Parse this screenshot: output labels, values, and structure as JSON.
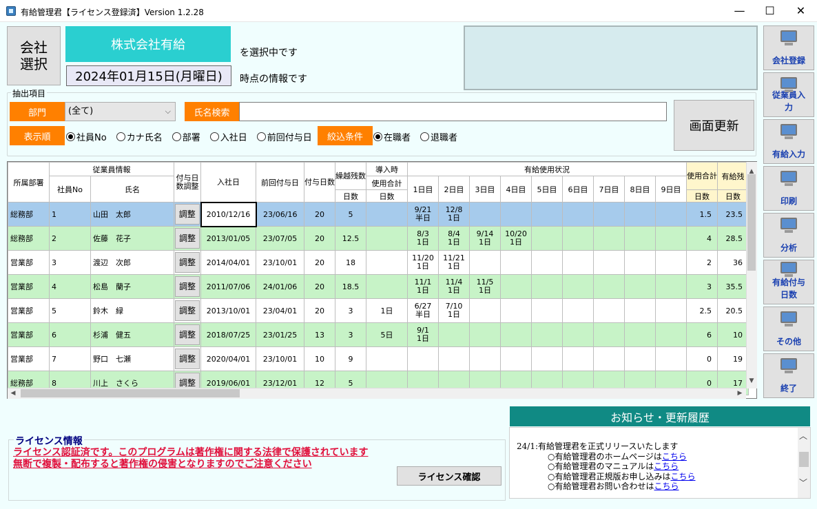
{
  "window": {
    "title": "有給管理君【ライセンス登録済】Version 1.2.28",
    "minimize": "—",
    "maximize": "☐",
    "close": "✕"
  },
  "top": {
    "company_select_label": "会社選択",
    "company_name": "株式会社有給",
    "selecting_text": "を選択中です",
    "date": "2024年01月15日(月曜日)",
    "asof_text": "時点の情報です"
  },
  "filter": {
    "legend": "抽出項目",
    "dept_label": "部門",
    "dept_value": "(全て)",
    "name_search_label": "氏名検索",
    "name_search_value": "",
    "sort_label": "表示順",
    "sort_options": [
      "社員No",
      "カナ氏名",
      "部署",
      "入社日",
      "前回付与日"
    ],
    "sort_selected": 0,
    "condition_label": "絞込条件",
    "condition_options": [
      "在職者",
      "退職者"
    ],
    "condition_selected": 0,
    "refresh_button": "画面更新"
  },
  "table": {
    "headers": {
      "dept": "所属部署",
      "employee_info": "従業員情報",
      "emp_no": "社員No",
      "name": "氏名",
      "adjust": "付与日数調整",
      "hire_date": "入社日",
      "last_grant": "前回付与日",
      "grant_days": "付与日数",
      "carryover": "繰越残数",
      "carryover_unit": "日数",
      "intro": "導入時",
      "intro_used": "使用合計",
      "intro_unit": "日数",
      "usage": "有給使用状況",
      "days": [
        "1日目",
        "2日目",
        "3日目",
        "4日目",
        "5日目",
        "6日目",
        "7日目",
        "8日目",
        "9日目"
      ],
      "used_total": "使用合計",
      "used_unit": "日数",
      "remaining": "有給残",
      "remaining_unit": "日数"
    },
    "adjust_button": "調整",
    "rows": [
      {
        "dept": "総務部",
        "no": "1",
        "name": "山田　太郎",
        "hire": "2010/12/16",
        "last": "23/06/16",
        "grant": "20",
        "carry": "5",
        "intro": "",
        "days": [
          [
            "9/21",
            "半日"
          ],
          [
            "12/8",
            "1日"
          ]
        ],
        "used": "1.5",
        "remain": "23.5",
        "style": "sel"
      },
      {
        "dept": "総務部",
        "no": "2",
        "name": "佐藤　花子",
        "hire": "2013/01/05",
        "last": "23/07/05",
        "grant": "20",
        "carry": "12.5",
        "intro": "",
        "days": [
          [
            "8/3",
            "1日"
          ],
          [
            "8/4",
            "1日"
          ],
          [
            "9/14",
            "1日"
          ],
          [
            "10/20",
            "1日"
          ]
        ],
        "used": "4",
        "remain": "28.5",
        "style": "green"
      },
      {
        "dept": "営業部",
        "no": "3",
        "name": "渡辺　次郎",
        "hire": "2014/04/01",
        "last": "23/10/01",
        "grant": "20",
        "carry": "18",
        "intro": "",
        "days": [
          [
            "11/20",
            "1日"
          ],
          [
            "11/21",
            "1日"
          ]
        ],
        "used": "2",
        "remain": "36",
        "style": "white"
      },
      {
        "dept": "営業部",
        "no": "4",
        "name": "松島　蘭子",
        "hire": "2011/07/06",
        "last": "24/01/06",
        "grant": "20",
        "carry": "18.5",
        "intro": "",
        "days": [
          [
            "11/1",
            "1日"
          ],
          [
            "11/4",
            "1日"
          ],
          [
            "11/5",
            "1日"
          ]
        ],
        "used": "3",
        "remain": "35.5",
        "style": "green"
      },
      {
        "dept": "営業部",
        "no": "5",
        "name": "鈴木　緑",
        "hire": "2013/10/01",
        "last": "23/04/01",
        "grant": "20",
        "carry": "3",
        "intro": "1日",
        "days": [
          [
            "6/27",
            "半日"
          ],
          [
            "7/10",
            "1日"
          ]
        ],
        "used": "2.5",
        "remain": "20.5",
        "style": "white"
      },
      {
        "dept": "営業部",
        "no": "6",
        "name": "杉浦　健五",
        "hire": "2018/07/25",
        "last": "23/01/25",
        "grant": "13",
        "carry": "3",
        "intro": "5日",
        "days": [
          [
            "9/1",
            "1日"
          ]
        ],
        "used": "6",
        "remain": "10",
        "style": "green"
      },
      {
        "dept": "営業部",
        "no": "7",
        "name": "野口　七瀬",
        "hire": "2020/04/01",
        "last": "23/10/01",
        "grant": "10",
        "carry": "9",
        "intro": "",
        "days": [],
        "used": "0",
        "remain": "19",
        "style": "white"
      },
      {
        "dept": "総務部",
        "no": "8",
        "name": "川上　さくら",
        "hire": "2019/06/01",
        "last": "23/12/01",
        "grant": "12",
        "carry": "5",
        "intro": "",
        "days": [],
        "used": "0",
        "remain": "17",
        "style": "green"
      }
    ]
  },
  "sidebar": {
    "items": [
      "会社登録",
      "従業員入力",
      "有給入力",
      "印刷",
      "分析",
      "有給付与日数",
      "その他",
      "終了"
    ]
  },
  "news": {
    "title": "お知らせ・更新履歴",
    "headline": "24/1:有給管理君を正式リリースいたします",
    "links": [
      {
        "text": "○有給管理君のホームページは",
        "link": "こちら"
      },
      {
        "text": "○有給管理君のマニュアルは",
        "link": "こちら"
      },
      {
        "text": "○有給管理君正規版お申し込みは",
        "link": "こちら"
      },
      {
        "text": "○有給管理君お問い合わせは",
        "link": "こちら"
      }
    ]
  },
  "license": {
    "title": "ライセンス情報",
    "line1": "ライセンス認証済です。このプログラムは著作権に関する法律で保護されています",
    "line2": "無断で複製・配布すると著作権の侵害となりますのでご注意ください",
    "button": "ライセンス確認"
  },
  "colors": {
    "accent_orange": "#ff8000",
    "company_teal": "#2acfd0",
    "news_teal": "#108a84",
    "row_green": "#c7f3c7",
    "row_selected": "#a6cbec",
    "license_red": "#e0103c"
  }
}
